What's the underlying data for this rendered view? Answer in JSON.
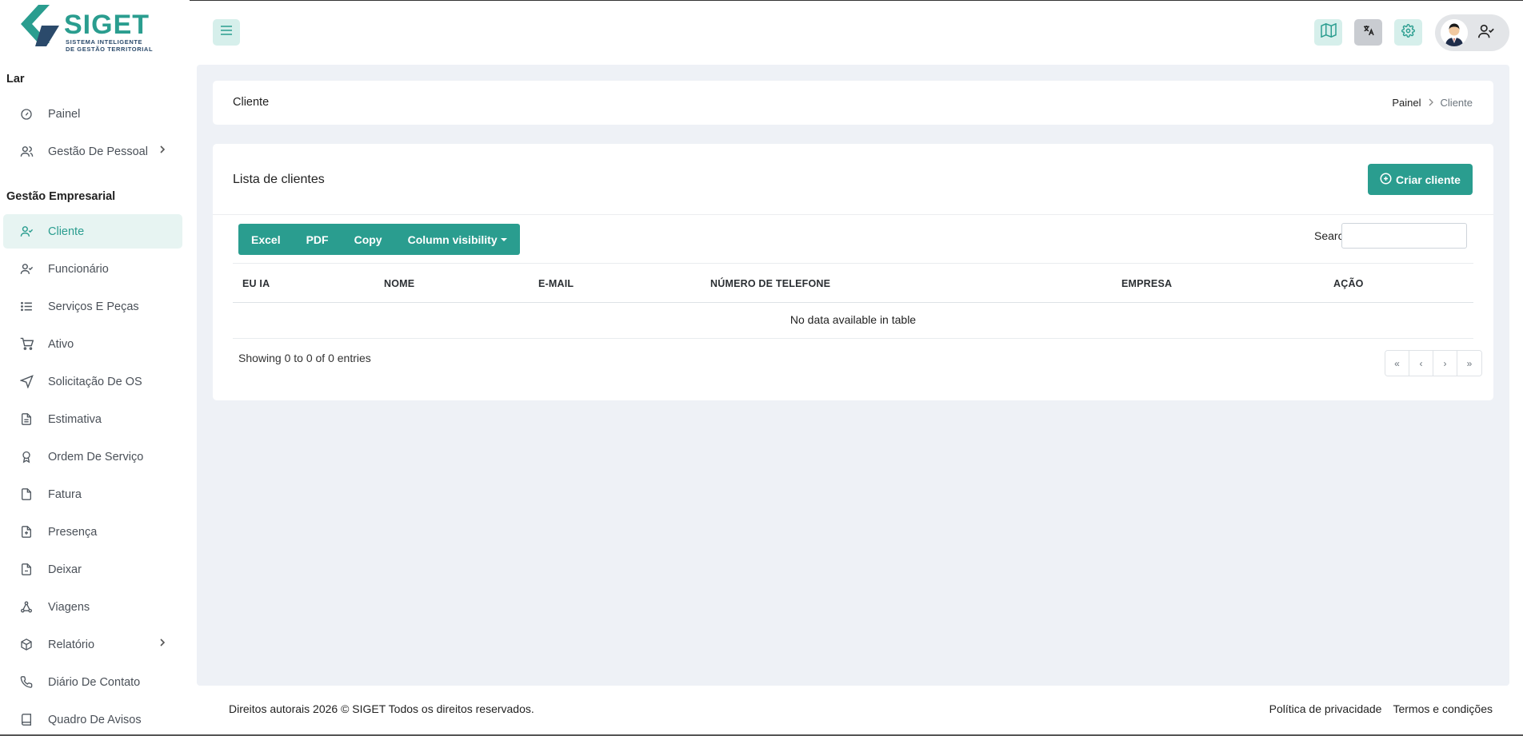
{
  "brand": {
    "name": "SIGET",
    "tagline_line1": "SISTEMA INTELIGENTE",
    "tagline_line2": "DE GESTÃO TERRITORIAL",
    "color_primary": "#2a9d8f",
    "color_dark": "#2b4a6b"
  },
  "sidebar": {
    "sections": [
      {
        "title": "Lar"
      },
      {
        "title": "Gestão Empresarial"
      }
    ],
    "items": [
      {
        "label": "Painel",
        "icon": "dashboard-icon"
      },
      {
        "label": "Gestão De Pessoal",
        "icon": "users-icon",
        "has_submenu": true
      },
      {
        "label": "Cliente",
        "icon": "user-check-icon",
        "active": true
      },
      {
        "label": "Funcionário",
        "icon": "user-check-icon"
      },
      {
        "label": "Serviços E Peças",
        "icon": "list-icon"
      },
      {
        "label": "Ativo",
        "icon": "cart-icon"
      },
      {
        "label": "Solicitação De OS",
        "icon": "send-icon"
      },
      {
        "label": "Estimativa",
        "icon": "file-text-icon"
      },
      {
        "label": "Ordem De Serviço",
        "icon": "award-icon"
      },
      {
        "label": "Fatura",
        "icon": "file-icon"
      },
      {
        "label": "Presença",
        "icon": "file-plus-icon"
      },
      {
        "label": "Deixar",
        "icon": "file-minus-icon"
      },
      {
        "label": "Viagens",
        "icon": "share-icon"
      },
      {
        "label": "Relatório",
        "icon": "box-icon",
        "has_submenu": true
      },
      {
        "label": "Diário De Contato",
        "icon": "phone-icon"
      },
      {
        "label": "Quadro De Avisos",
        "icon": "book-icon"
      }
    ]
  },
  "header": {
    "menu_icon": "hamburger-icon",
    "buttons": [
      {
        "icon": "map-icon",
        "bg": "#d6efeb",
        "color": "#2a9d8f"
      },
      {
        "icon": "translate-icon",
        "bg": "#c9ccd1",
        "color": "#222"
      },
      {
        "icon": "gear-icon",
        "bg": "#d6efeb",
        "color": "#2a9d8f"
      }
    ],
    "user_icon": "user-check-icon"
  },
  "page": {
    "title": "Cliente",
    "breadcrumb": {
      "home": "Painel",
      "current": "Cliente"
    }
  },
  "list": {
    "title": "Lista de clientes",
    "create_button": "Criar cliente",
    "export_buttons": [
      "Excel",
      "PDF",
      "Copy",
      "Column visibility"
    ],
    "search_label": "Search:",
    "search_value": "",
    "columns": [
      "EU IA",
      "NOME",
      "E-MAIL",
      "NÚMERO DE TELEFONE",
      "EMPRESA",
      "AÇÃO"
    ],
    "empty_message": "No data available in table",
    "entries_info": "Showing 0 to 0 of 0 entries",
    "pagination": [
      "«",
      "‹",
      "›",
      "»"
    ]
  },
  "footer": {
    "copyright": "Direitos autorais 2026 © SIGET Todos os direitos reservados.",
    "links": [
      "Política de privacidade",
      "Termos e condições"
    ]
  }
}
